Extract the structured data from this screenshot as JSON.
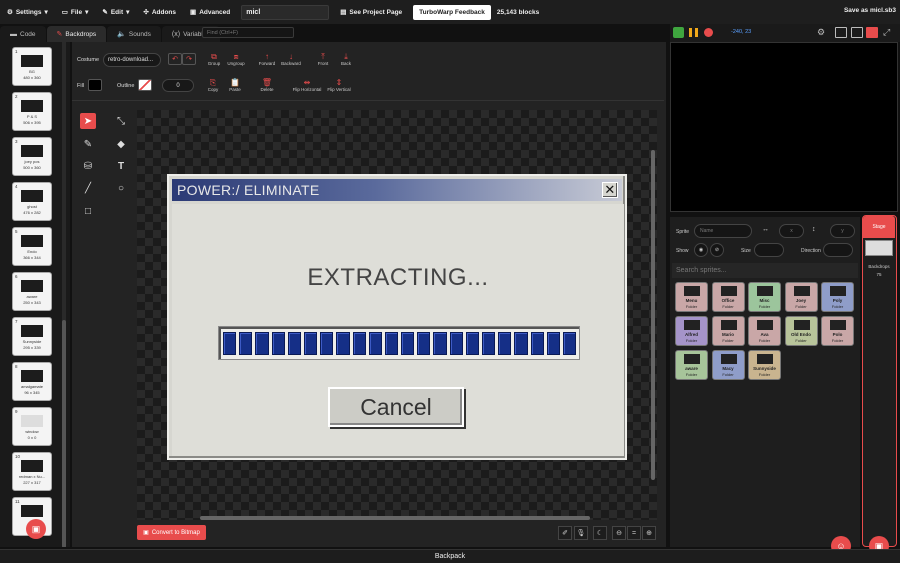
{
  "menubar": {
    "settings": "Settings",
    "file": "File",
    "edit": "Edit",
    "addons": "Addons",
    "advanced": "Advanced",
    "project_title": "micl",
    "see_project": "See Project Page",
    "feedback": "TurboWarp Feedback",
    "blocks": "25,143 blocks",
    "save_as": "Save as micl.sb3"
  },
  "tabs": {
    "code": "Code",
    "backdrops": "Backdrops",
    "sounds": "Sounds",
    "variables": "Variables"
  },
  "find_placeholder": "Find (Ctrl+F)",
  "costumes": [
    {
      "num": "1",
      "name": "BG",
      "dims": "480 x 360"
    },
    {
      "num": "2",
      "name": "P & S",
      "dims": "506 x 395"
    },
    {
      "num": "3",
      "name": "joey pos",
      "dims": "500 x 360"
    },
    {
      "num": "4",
      "name": "ghost",
      "dims": "476 x 282"
    },
    {
      "num": "5",
      "name": "Endo",
      "dims": "366 x 344"
    },
    {
      "num": "6",
      "name": "aware",
      "dims": "250 x 343"
    },
    {
      "num": "7",
      "name": "Sunnyside",
      "dims": "295 x 339"
    },
    {
      "num": "8",
      "name": "amalgamate",
      "dims": "96 x 345"
    },
    {
      "num": "9",
      "name": "window",
      "dims": "0 x 0"
    },
    {
      "num": "10",
      "name": "redman x Nu...",
      "dims": "227 x 317"
    },
    {
      "num": "11",
      "name": "",
      "dims": ""
    }
  ],
  "paint": {
    "costume_label": "Costume",
    "costume_name": "retro-download...",
    "group": "Group",
    "ungroup": "Ungroup",
    "forward": "Forward",
    "backward": "Backward",
    "front": "Front",
    "back": "Back",
    "fill": "Fill",
    "outline": "Outline",
    "outline_width": "0",
    "copy": "Copy",
    "paste": "Paste",
    "delete": "Delete",
    "flip_h": "Flip Horizontal",
    "flip_v": "Flip Vertical",
    "convert": "Convert to Bitmap"
  },
  "dialog": {
    "title": "POWER:/ ELIMINATE",
    "message": "EXTRACTING...",
    "progress": 1.0,
    "cancel": "Cancel",
    "title_color_start": "#2b3a75",
    "progress_color": "#152f87"
  },
  "stage": {
    "coords": "-240, 23"
  },
  "sprite_info": {
    "sprite_label": "Sprite",
    "name_placeholder": "Name",
    "x_placeholder": "x",
    "y_placeholder": "y",
    "show": "Show",
    "size": "Size",
    "direction": "Direction",
    "search_placeholder": "Search sprites..."
  },
  "sprites": [
    {
      "name": "Menu",
      "sub": "Folder",
      "color": "#c9a7a7"
    },
    {
      "name": "Office",
      "sub": "Folder",
      "color": "#c9a7a7"
    },
    {
      "name": "Misc",
      "sub": "Folder",
      "color": "#9cc59c"
    },
    {
      "name": "Joey",
      "sub": "Folder",
      "color": "#c9a7a7"
    },
    {
      "name": "Poly",
      "sub": "Folder",
      "color": "#8f9dc9"
    },
    {
      "name": "Alfred",
      "sub": "Folder",
      "color": "#a594c9"
    },
    {
      "name": "Mario",
      "sub": "Folder",
      "color": "#c9a7a7"
    },
    {
      "name": "Ava",
      "sub": "Folder",
      "color": "#c9a7a7"
    },
    {
      "name": "Old Endo",
      "sub": "Folder",
      "color": "#b8c49a"
    },
    {
      "name": "Polo",
      "sub": "Folder",
      "color": "#c9a7a7"
    },
    {
      "name": "aware",
      "sub": "Folder",
      "color": "#a7c49a"
    },
    {
      "name": "Macy",
      "sub": "Folder",
      "color": "#8f9dc9"
    },
    {
      "name": "Sunnyside",
      "sub": "Folder",
      "color": "#c9b48f"
    }
  ],
  "stage_panel": {
    "title": "Stage",
    "backdrops_label": "Backdrops",
    "backdrops_count": "75"
  },
  "backpack": "Backpack",
  "accent": "#e84c4c"
}
